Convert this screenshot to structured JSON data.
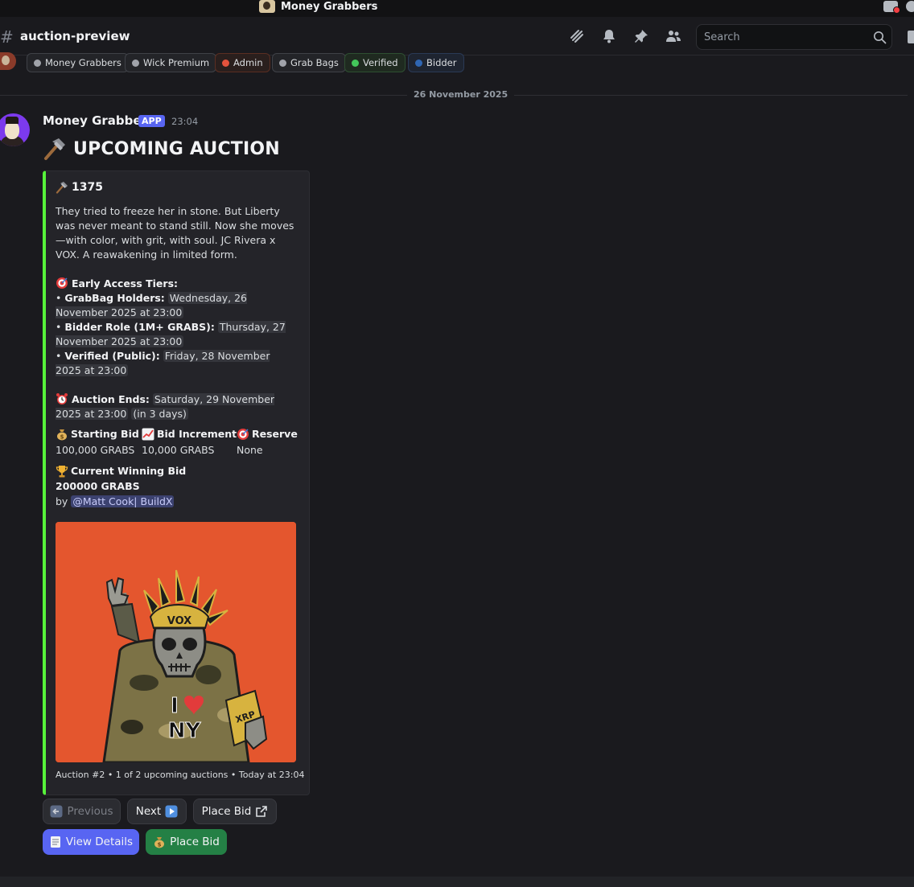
{
  "window": {
    "title": "Money Grabbers"
  },
  "channel": {
    "name": "auction-preview",
    "search_placeholder": "Search"
  },
  "roles": [
    {
      "label": "Money Grabbers",
      "color": "#a0a3aa"
    },
    {
      "label": "Wick Premium",
      "color": "#a0a3aa"
    },
    {
      "label": "Admin",
      "color": "#e5533d"
    },
    {
      "label": "Grab Bags",
      "color": "#a0a3aa"
    },
    {
      "label": "Verified",
      "color": "#43c75a"
    },
    {
      "label": "Bidder",
      "color": "#2f66b3"
    }
  ],
  "date_divider": "26 November 2025",
  "message": {
    "author": "Money Grabbers",
    "app_tag": "APP",
    "time": "23:04",
    "title": "UPCOMING AUCTION",
    "embed": {
      "title": "1375",
      "description": "They tried to freeze her in stone. But Liberty was never meant to stand still. Now she moves—with color, with grit, with soul. JC Rivera x VOX. A reawakening in limited form.",
      "tiers_heading": "Early Access Tiers:",
      "tiers": [
        {
          "label": "GrabBag Holders:",
          "time": "Wednesday, 26 November 2025 at 23:00"
        },
        {
          "label": "Bidder Role (1M+ GRABS):",
          "time": "Thursday, 27 November 2025 at 23:00"
        },
        {
          "label": "Verified (Public):",
          "time": "Friday, 28 November 2025 at 23:00"
        }
      ],
      "ends_label": "Auction Ends:",
      "ends_time": "Saturday, 29 November 2025 at 23:00",
      "ends_relative": "in 3 days",
      "fields": [
        {
          "name": "Starting Bid",
          "value": "100,000 GRABS",
          "icon": "money-bag-icon"
        },
        {
          "name": "Bid Increment",
          "value": "10,000 GRABS",
          "icon": "chart-up-icon"
        },
        {
          "name": "Reserve",
          "value": "None",
          "icon": "target-icon"
        }
      ],
      "winning_label": "Current Winning Bid",
      "winning_amount": "200000 GRABS",
      "winning_by": "by",
      "winning_user": "@Matt Cook| BuildX",
      "image_text": {
        "crown": "VOX",
        "shirt_line1": "I",
        "shirt_line2": "NY",
        "tag": "XRP"
      },
      "footer": "Auction #2 • 1 of 2 upcoming auctions • Today at 23:04",
      "accent_color": "#57f23a"
    },
    "buttons": {
      "previous": "Previous",
      "next": "Next",
      "place_bid_link": "Place Bid",
      "view_details": "View Details",
      "place_bid": "Place Bid"
    }
  }
}
